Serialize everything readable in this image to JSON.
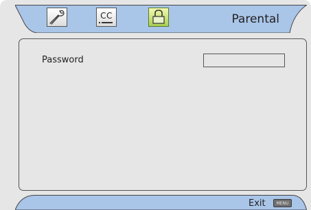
{
  "header": {
    "title": "Parental",
    "tabs": [
      {
        "name": "setup",
        "icon": "wrench-icon"
      },
      {
        "name": "cc",
        "label": "CC",
        "icon": "cc-icon"
      },
      {
        "name": "parental",
        "icon": "lock-icon",
        "active": true
      }
    ]
  },
  "content": {
    "password_label": "Password",
    "password_value": ""
  },
  "footer": {
    "exit_label": "Exit",
    "menu_badge": "MENU"
  },
  "colors": {
    "panel_bg": "#e6e6e6",
    "bar_fill": "#a9c5e8",
    "active_tab": "#a8cf52"
  }
}
